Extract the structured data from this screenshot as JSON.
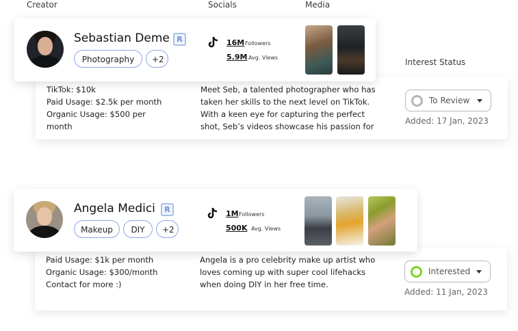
{
  "columns": {
    "creator": "Creator",
    "socials": "Socials",
    "media": "Media",
    "interest_status": "Interest Status"
  },
  "creators": [
    {
      "name": "Sebastian Deme",
      "badge": "R",
      "tags": [
        "Photography",
        "+2"
      ],
      "followers": "16M",
      "followers_label": "Followers",
      "views": "5.9M",
      "views_label": "Avg. Views",
      "rates": [
        "TikTok: $10k",
        "Paid Usage: $2.5k per month",
        "Organic Usage: $500 per",
        "month"
      ],
      "bio": [
        "Meet Seb, a talented photographer who has",
        "taken her skills to the next level on TikTok.",
        "With a keen eye for capturing the perfect",
        "shot, Seb’s videos showcase his passion for"
      ],
      "status": "To Review",
      "status_color": "#b5b5b5",
      "added": "Added: 17 Jan, 2023"
    },
    {
      "name": "Angela Medici",
      "badge": "R",
      "tags": [
        "Makeup",
        "DIY",
        "+2"
      ],
      "followers": "1M",
      "followers_label": "Followers",
      "views": "500K",
      "views_label": "Avg. Views",
      "rates": [
        "Paid Usage: $1k per month",
        "Organic Usage: $300/month",
        "Contact for more :)"
      ],
      "bio": [
        "Angela is a pro celebrity make up artist who",
        "loves coming up with super cool lifehacks",
        "when doing DIY in her free time."
      ],
      "status": "Interested",
      "status_color": "#7ed321",
      "added": "Added: 11 Jan, 2023"
    }
  ]
}
